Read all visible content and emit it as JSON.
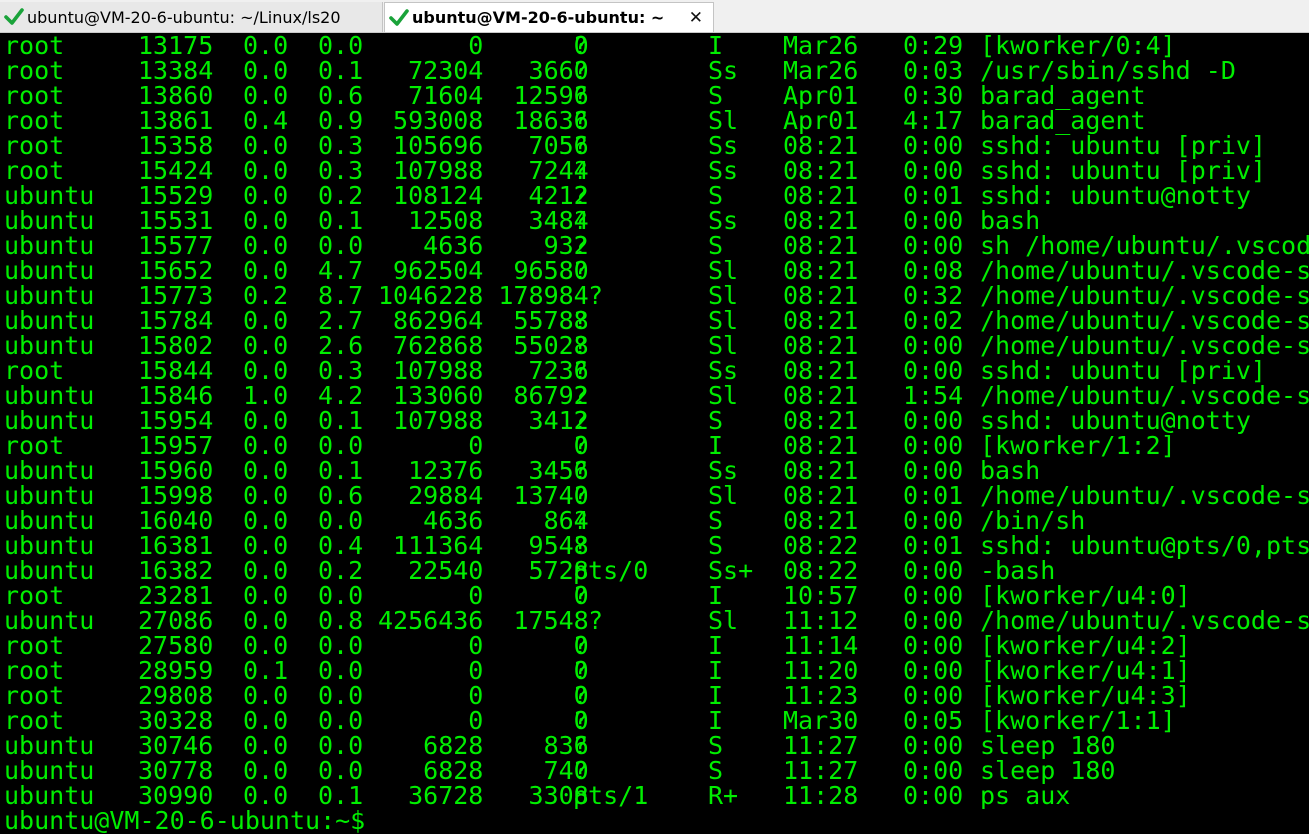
{
  "tabs": [
    {
      "title": "ubuntu@VM-20-6-ubuntu: ~/Linux/ls20",
      "active": false,
      "status_icon": "green-check-icon"
    },
    {
      "title": "ubuntu@VM-20-6-ubuntu: ~",
      "active": true,
      "status_icon": "green-check-icon",
      "close_label": "✕"
    }
  ],
  "colors": {
    "terminal_background": "#000000",
    "terminal_text": "#00ee00",
    "check": "#1aa33a"
  },
  "terminal": {
    "rows": [
      {
        "user": "root",
        "pid": "13175",
        "cpu": "0.0",
        "mem": "0.0",
        "vsz_rss": "      0      0",
        "tty": "?",
        "stat": "I",
        "start": "Mar26",
        "time": "0:29",
        "command": "[kworker/0:4]"
      },
      {
        "user": "root",
        "pid": "13384",
        "cpu": "0.0",
        "mem": "0.1",
        "vsz_rss": "  72304   3660",
        "tty": "?",
        "stat": "Ss",
        "start": "Mar26",
        "time": "0:03",
        "command": "/usr/sbin/sshd -D"
      },
      {
        "user": "root",
        "pid": "13860",
        "cpu": "0.0",
        "mem": "0.6",
        "vsz_rss": "  71604  12596",
        "tty": "?",
        "stat": "S",
        "start": "Apr01",
        "time": "0:30",
        "command": "barad_agent"
      },
      {
        "user": "root",
        "pid": "13861",
        "cpu": "0.4",
        "mem": "0.9",
        "vsz_rss": " 593008  18636",
        "tty": "?",
        "stat": "Sl",
        "start": "Apr01",
        "time": "4:17",
        "command": "barad_agent"
      },
      {
        "user": "root",
        "pid": "15358",
        "cpu": "0.0",
        "mem": "0.3",
        "vsz_rss": " 105696   7056",
        "tty": "?",
        "stat": "Ss",
        "start": "08:21",
        "time": "0:00",
        "command": "sshd: ubuntu [priv]"
      },
      {
        "user": "root",
        "pid": "15424",
        "cpu": "0.0",
        "mem": "0.3",
        "vsz_rss": " 107988   7244",
        "tty": "?",
        "stat": "Ss",
        "start": "08:21",
        "time": "0:00",
        "command": "sshd: ubuntu [priv]"
      },
      {
        "user": "ubuntu",
        "pid": "15529",
        "cpu": "0.0",
        "mem": "0.2",
        "vsz_rss": " 108124   4212",
        "tty": "?",
        "stat": "S",
        "start": "08:21",
        "time": "0:01",
        "command": "sshd: ubuntu@notty"
      },
      {
        "user": "ubuntu",
        "pid": "15531",
        "cpu": "0.0",
        "mem": "0.1",
        "vsz_rss": "  12508   3484",
        "tty": "?",
        "stat": "Ss",
        "start": "08:21",
        "time": "0:00",
        "command": "bash"
      },
      {
        "user": "ubuntu",
        "pid": "15577",
        "cpu": "0.0",
        "mem": "0.0",
        "vsz_rss": "   4636    932",
        "tty": "?",
        "stat": "S",
        "start": "08:21",
        "time": "0:00",
        "command": "sh /home/ubuntu/.vscod"
      },
      {
        "user": "ubuntu",
        "pid": "15652",
        "cpu": "0.0",
        "mem": "4.7",
        "vsz_rss": " 962504  96580",
        "tty": "?",
        "stat": "Sl",
        "start": "08:21",
        "time": "0:08",
        "command": "/home/ubuntu/.vscode-s"
      },
      {
        "user": "ubuntu",
        "pid": "15773",
        "cpu": "0.2",
        "mem": "8.7",
        "vsz_rss": "1046228 178984",
        "tty": " ?",
        "stat": "Sl",
        "start": "08:21",
        "time": "0:32",
        "command": "/home/ubuntu/.vscode-s"
      },
      {
        "user": "ubuntu",
        "pid": "15784",
        "cpu": "0.0",
        "mem": "2.7",
        "vsz_rss": " 862964  55788",
        "tty": "?",
        "stat": "Sl",
        "start": "08:21",
        "time": "0:02",
        "command": "/home/ubuntu/.vscode-s"
      },
      {
        "user": "ubuntu",
        "pid": "15802",
        "cpu": "0.0",
        "mem": "2.6",
        "vsz_rss": " 762868  55028",
        "tty": "?",
        "stat": "Sl",
        "start": "08:21",
        "time": "0:00",
        "command": "/home/ubuntu/.vscode-s"
      },
      {
        "user": "root",
        "pid": "15844",
        "cpu": "0.0",
        "mem": "0.3",
        "vsz_rss": " 107988   7236",
        "tty": "?",
        "stat": "Ss",
        "start": "08:21",
        "time": "0:00",
        "command": "sshd: ubuntu [priv]"
      },
      {
        "user": "ubuntu",
        "pid": "15846",
        "cpu": "1.0",
        "mem": "4.2",
        "vsz_rss": " 133060  86792",
        "tty": "?",
        "stat": "Sl",
        "start": "08:21",
        "time": "1:54",
        "command": "/home/ubuntu/.vscode-s"
      },
      {
        "user": "ubuntu",
        "pid": "15954",
        "cpu": "0.0",
        "mem": "0.1",
        "vsz_rss": " 107988   3412",
        "tty": "?",
        "stat": "S",
        "start": "08:21",
        "time": "0:00",
        "command": "sshd: ubuntu@notty"
      },
      {
        "user": "root",
        "pid": "15957",
        "cpu": "0.0",
        "mem": "0.0",
        "vsz_rss": "      0      0",
        "tty": "?",
        "stat": "I",
        "start": "08:21",
        "time": "0:00",
        "command": "[kworker/1:2]"
      },
      {
        "user": "ubuntu",
        "pid": "15960",
        "cpu": "0.0",
        "mem": "0.1",
        "vsz_rss": "  12376   3456",
        "tty": "?",
        "stat": "Ss",
        "start": "08:21",
        "time": "0:00",
        "command": "bash"
      },
      {
        "user": "ubuntu",
        "pid": "15998",
        "cpu": "0.0",
        "mem": "0.6",
        "vsz_rss": "  29884  13740",
        "tty": "?",
        "stat": "Sl",
        "start": "08:21",
        "time": "0:01",
        "command": "/home/ubuntu/.vscode-s"
      },
      {
        "user": "ubuntu",
        "pid": "16040",
        "cpu": "0.0",
        "mem": "0.0",
        "vsz_rss": "   4636    864",
        "tty": "?",
        "stat": "S",
        "start": "08:21",
        "time": "0:00",
        "command": "/bin/sh"
      },
      {
        "user": "ubuntu",
        "pid": "16381",
        "cpu": "0.0",
        "mem": "0.4",
        "vsz_rss": " 111364   9548",
        "tty": "?",
        "stat": "S",
        "start": "08:22",
        "time": "0:01",
        "command": "sshd: ubuntu@pts/0,pts"
      },
      {
        "user": "ubuntu",
        "pid": "16382",
        "cpu": "0.0",
        "mem": "0.2",
        "vsz_rss": "  22540   5728",
        "tty": "pts/0",
        "stat": "Ss+",
        "start": "08:22",
        "time": "0:00",
        "command": "-bash"
      },
      {
        "user": "root",
        "pid": "23281",
        "cpu": "0.0",
        "mem": "0.0",
        "vsz_rss": "      0      0",
        "tty": "?",
        "stat": "I",
        "start": "10:57",
        "time": "0:00",
        "command": "[kworker/u4:0]"
      },
      {
        "user": "ubuntu",
        "pid": "27086",
        "cpu": "0.0",
        "mem": "0.8",
        "vsz_rss": "4256436  17548",
        "tty": " ?",
        "stat": "Sl",
        "start": "11:12",
        "time": "0:00",
        "command": "/home/ubuntu/.vscode-s"
      },
      {
        "user": "root",
        "pid": "27580",
        "cpu": "0.0",
        "mem": "0.0",
        "vsz_rss": "      0      0",
        "tty": "?",
        "stat": "I",
        "start": "11:14",
        "time": "0:00",
        "command": "[kworker/u4:2]"
      },
      {
        "user": "root",
        "pid": "28959",
        "cpu": "0.1",
        "mem": "0.0",
        "vsz_rss": "      0      0",
        "tty": "?",
        "stat": "I",
        "start": "11:20",
        "time": "0:00",
        "command": "[kworker/u4:1]"
      },
      {
        "user": "root",
        "pid": "29808",
        "cpu": "0.0",
        "mem": "0.0",
        "vsz_rss": "      0      0",
        "tty": "?",
        "stat": "I",
        "start": "11:23",
        "time": "0:00",
        "command": "[kworker/u4:3]"
      },
      {
        "user": "root",
        "pid": "30328",
        "cpu": "0.0",
        "mem": "0.0",
        "vsz_rss": "      0      0",
        "tty": "?",
        "stat": "I",
        "start": "Mar30",
        "time": "0:05",
        "command": "[kworker/1:1]"
      },
      {
        "user": "ubuntu",
        "pid": "30746",
        "cpu": "0.0",
        "mem": "0.0",
        "vsz_rss": "   6828    836",
        "tty": "?",
        "stat": "S",
        "start": "11:27",
        "time": "0:00",
        "command": "sleep 180"
      },
      {
        "user": "ubuntu",
        "pid": "30778",
        "cpu": "0.0",
        "mem": "0.0",
        "vsz_rss": "   6828    740",
        "tty": "?",
        "stat": "S",
        "start": "11:27",
        "time": "0:00",
        "command": "sleep 180"
      },
      {
        "user": "ubuntu",
        "pid": "30990",
        "cpu": "0.0",
        "mem": "0.1",
        "vsz_rss": "  36728   3308",
        "tty": "pts/1",
        "stat": "R+",
        "start": "11:28",
        "time": "0:00",
        "command": "ps aux"
      }
    ],
    "prompt": "ubuntu@VM-20-6-ubuntu:~$"
  }
}
